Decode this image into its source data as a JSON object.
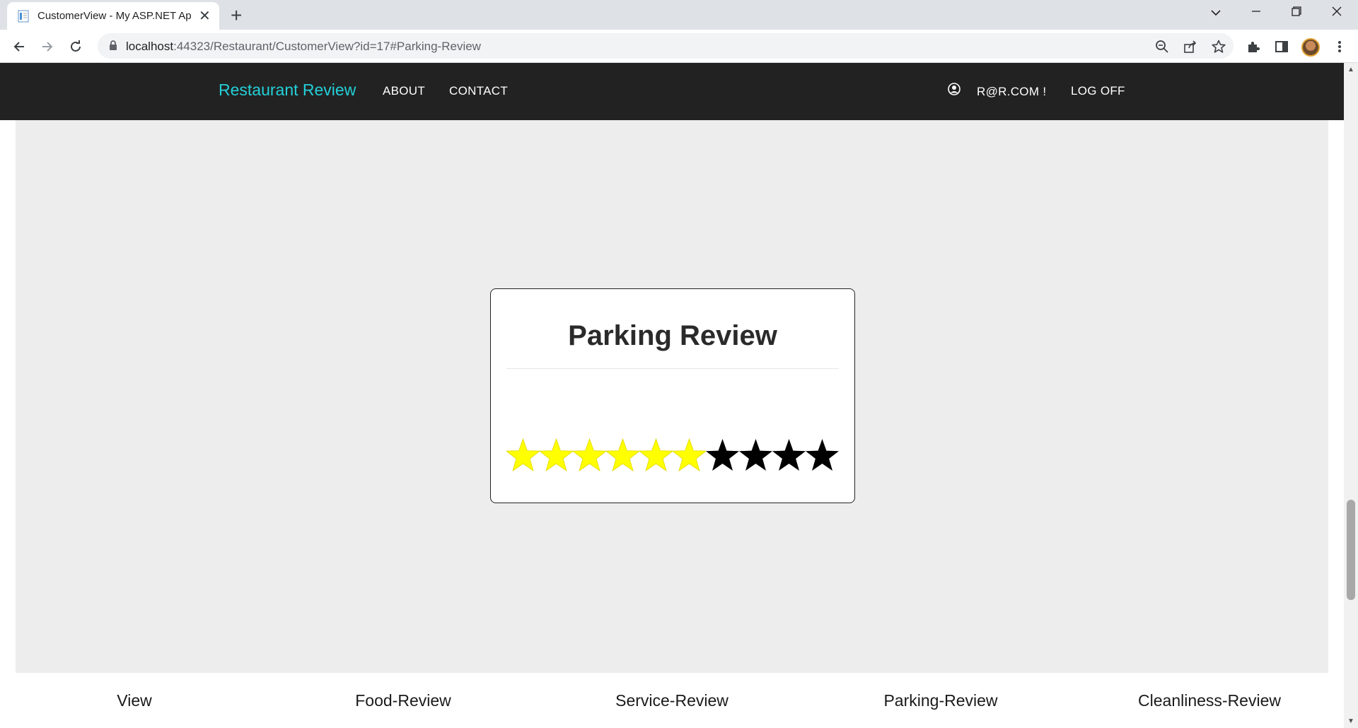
{
  "browser": {
    "tab_title": "CustomerView - My ASP.NET Application",
    "new_tab": "+",
    "url_host": "localhost",
    "url_rest": ":44323/Restaurant/CustomerView?id=17#Parking-Review"
  },
  "navbar": {
    "brand": "Restaurant Review",
    "about": "ABOUT",
    "contact": "CONTACT",
    "user": "R@R.COM !",
    "logoff": "LOG OFF",
    "brand_color": "#23d0d8"
  },
  "card": {
    "title": "Parking Review",
    "rating": 6,
    "max_rating": 10,
    "filled_color": "#ffff00",
    "empty_color": "#000000"
  },
  "bottom_nav": {
    "items": [
      "View",
      "Food-Review",
      "Service-Review",
      "Parking-Review",
      "Cleanliness-Review"
    ]
  }
}
